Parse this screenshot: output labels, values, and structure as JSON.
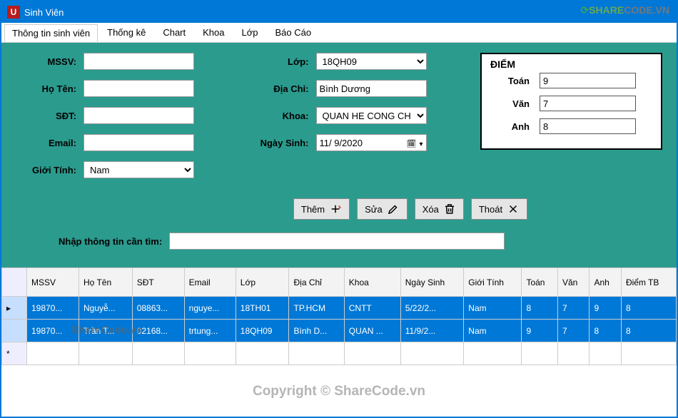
{
  "window": {
    "title": "Sinh Viên",
    "icon_letter": "U"
  },
  "watermark_top": {
    "g": "⟳",
    "s1": "SHARE",
    "s2": "CODE",
    "tld": ".VN"
  },
  "win_controls": {
    "min": "—",
    "max": "🗗",
    "close": "×"
  },
  "tabs": [
    {
      "label": "Thông tin sinh viên",
      "active": true
    },
    {
      "label": "Thống kê"
    },
    {
      "label": "Chart"
    },
    {
      "label": "Khoa"
    },
    {
      "label": "Lớp"
    },
    {
      "label": "Báo Cáo"
    }
  ],
  "labels": {
    "mssv": "MSSV:",
    "hoten": "Họ Tên:",
    "sdt": "SĐT:",
    "email": "Email:",
    "gioitinh": "Giới Tính:",
    "lop": "Lớp:",
    "diachi": "Địa Chỉ:",
    "khoa": "Khoa:",
    "ngaysinh": "Ngày Sinh:"
  },
  "form": {
    "mssv": "",
    "hoten": "",
    "sdt": "",
    "email": "",
    "gioitinh": "Nam",
    "lop": "18QH09",
    "diachi": "Bình Dương",
    "khoa": "QUAN HE CONG CH",
    "ngaysinh": "11/  9/2020"
  },
  "score": {
    "header": "ĐIỂM",
    "toan_label": "Toán",
    "van_label": "Văn",
    "anh_label": "Anh",
    "toan": "9",
    "van": "7",
    "anh": "8"
  },
  "buttons": {
    "them": "Thêm",
    "sua": "Sửa",
    "xoa": "Xóa",
    "thoat": "Thoát"
  },
  "search": {
    "label": "Nhập thông tin cần tìm:",
    "value": ""
  },
  "grid": {
    "headers": [
      "",
      "MSSV",
      "Họ Tên",
      "SĐT",
      "Email",
      "Lớp",
      "Địa Chỉ",
      "Khoa",
      "Ngày Sinh",
      "Giới Tính",
      "Toán",
      "Văn",
      "Anh",
      "Điểm TB"
    ],
    "rows": [
      {
        "rowhead": "▸",
        "cells": [
          "19870...",
          "Nguyễ...",
          "08863...",
          "nguye...",
          "18TH01",
          "TP.HCM",
          "CNTT",
          "5/22/2...",
          "Nam",
          "8",
          "7",
          "9",
          "8"
        ]
      },
      {
        "rowhead": "",
        "cells": [
          "19870...",
          "Trần T...",
          "02168...",
          "trtung...",
          "18QH09",
          "Bình D...",
          "QUAN ...",
          "11/9/2...",
          "Nam",
          "9",
          "7",
          "8",
          "8"
        ]
      }
    ]
  },
  "body_watermark": "ShareCode.vn",
  "footer_watermark": "Copyright © ShareCode.vn"
}
